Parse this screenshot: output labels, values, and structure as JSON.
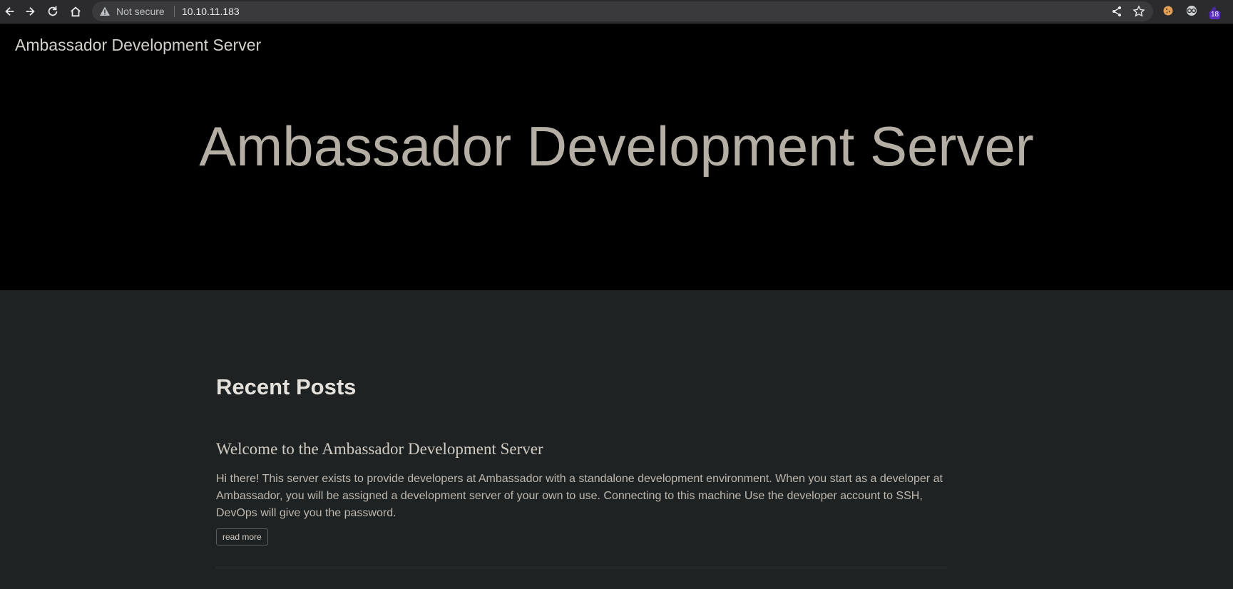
{
  "browser": {
    "security_label": "Not secure",
    "url": "10.10.11.183",
    "extension_badge": "18",
    "icons": [
      "back-icon",
      "forward-icon",
      "reload-icon",
      "home-icon",
      "warning-icon",
      "share-icon",
      "bookmark-star-icon",
      "cookie-extension-icon",
      "glasses-extension-icon",
      "hat-extension-icon"
    ]
  },
  "site": {
    "brand": "Ambassador Development Server",
    "hero_title": "Ambassador Development Server"
  },
  "main": {
    "section_heading": "Recent Posts",
    "posts": [
      {
        "title": "Welcome to the Ambassador Development Server",
        "excerpt": "Hi there! This server exists to provide developers at Ambassador with a standalone development environment. When you start as a developer at Ambassador, you will be assigned a development server of your own to use. Connecting to this machine Use the developer account to SSH, DevOps will give you the password.",
        "read_more_label": "read more"
      }
    ]
  },
  "colors": {
    "hero_background": "#000000",
    "page_background": "#1f2223",
    "hero_title": "#b4aea4",
    "brand_text": "#d4d0ca"
  }
}
